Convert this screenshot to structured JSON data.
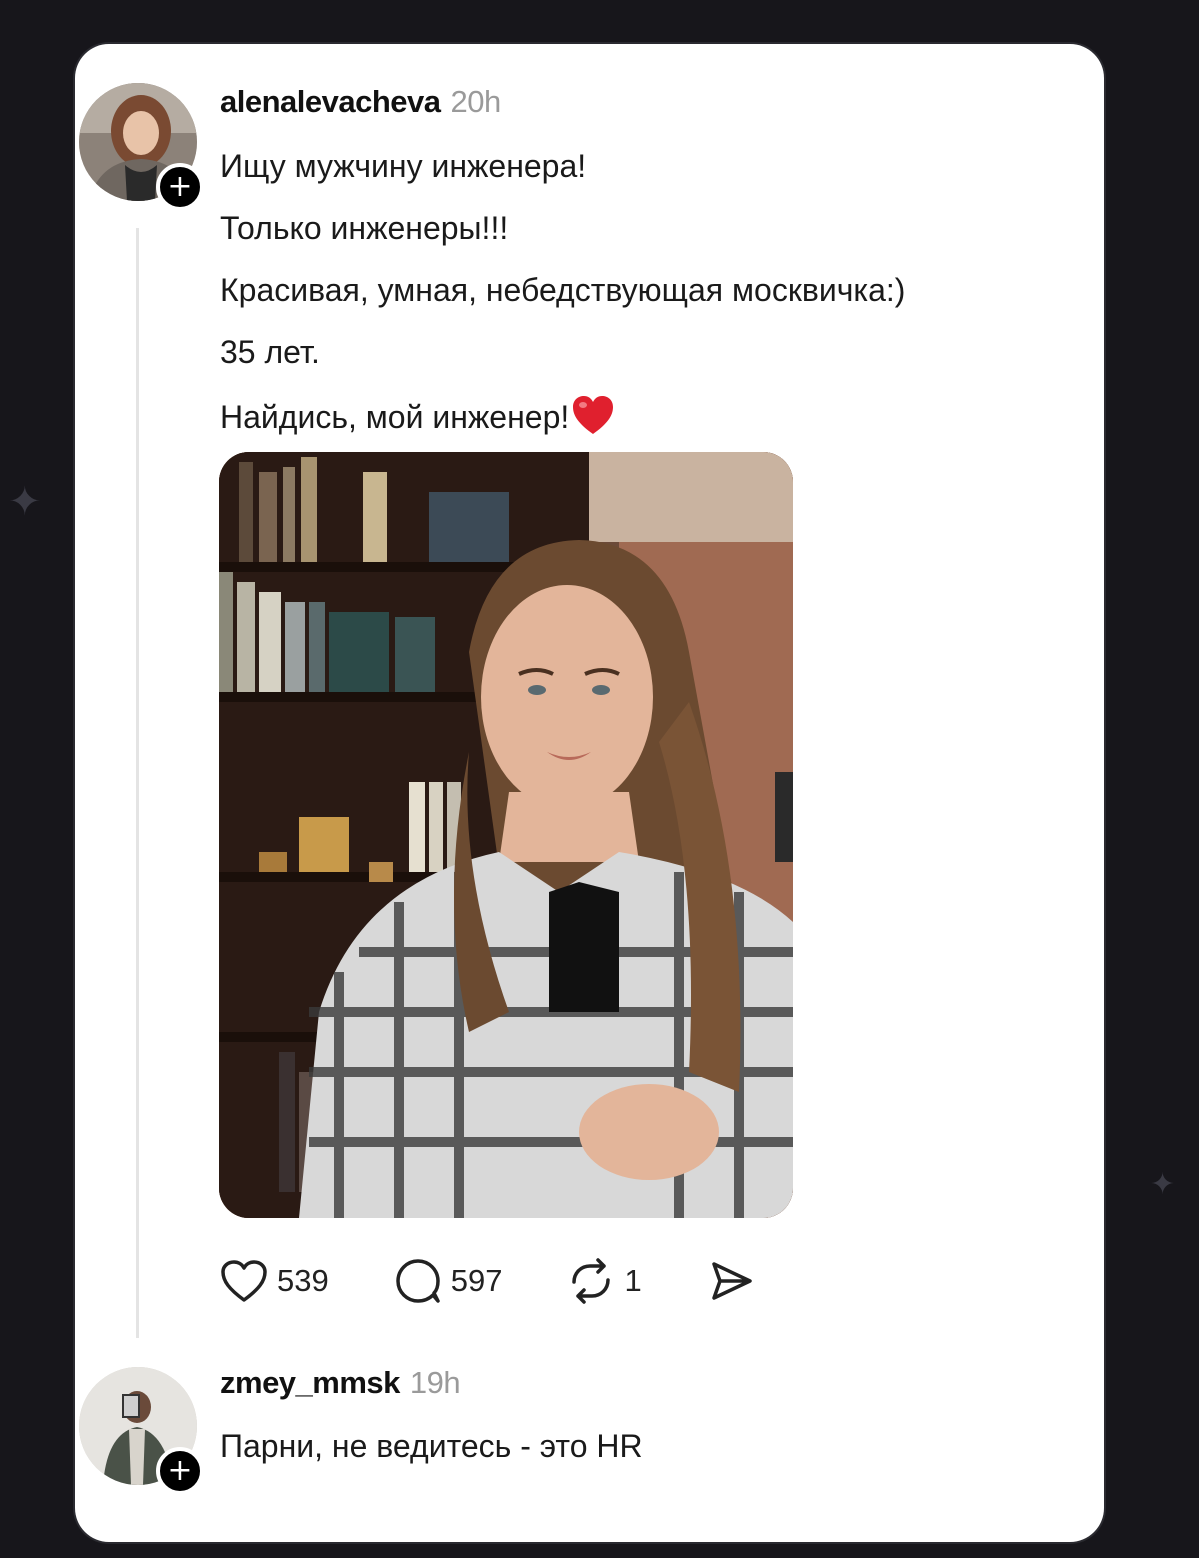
{
  "post": {
    "username": "alenalevacheva",
    "time": "20h",
    "lines": [
      "Ищу мужчину инженера!",
      "Только инженеры!!!",
      "Красивая, умная, небедствующая москвичка:)",
      "35 лет.",
      "Найдись, мой инженер!"
    ],
    "emoji": "red-heart-emoji",
    "stats": {
      "likes": "539",
      "comments": "597",
      "reposts": "1"
    }
  },
  "reply": {
    "username": "zmey_mmsk",
    "time": "19h",
    "text": "Парни, не ведитесь - это HR"
  },
  "icons": {
    "follow": "+",
    "like": "heart-icon",
    "comment": "comment-bubble-icon",
    "repost": "repost-icon",
    "share": "send-icon"
  },
  "colors": {
    "background": "#17161b",
    "card": "#ffffff",
    "muted_text": "#9a9a9a",
    "heart": "#e0202e"
  }
}
